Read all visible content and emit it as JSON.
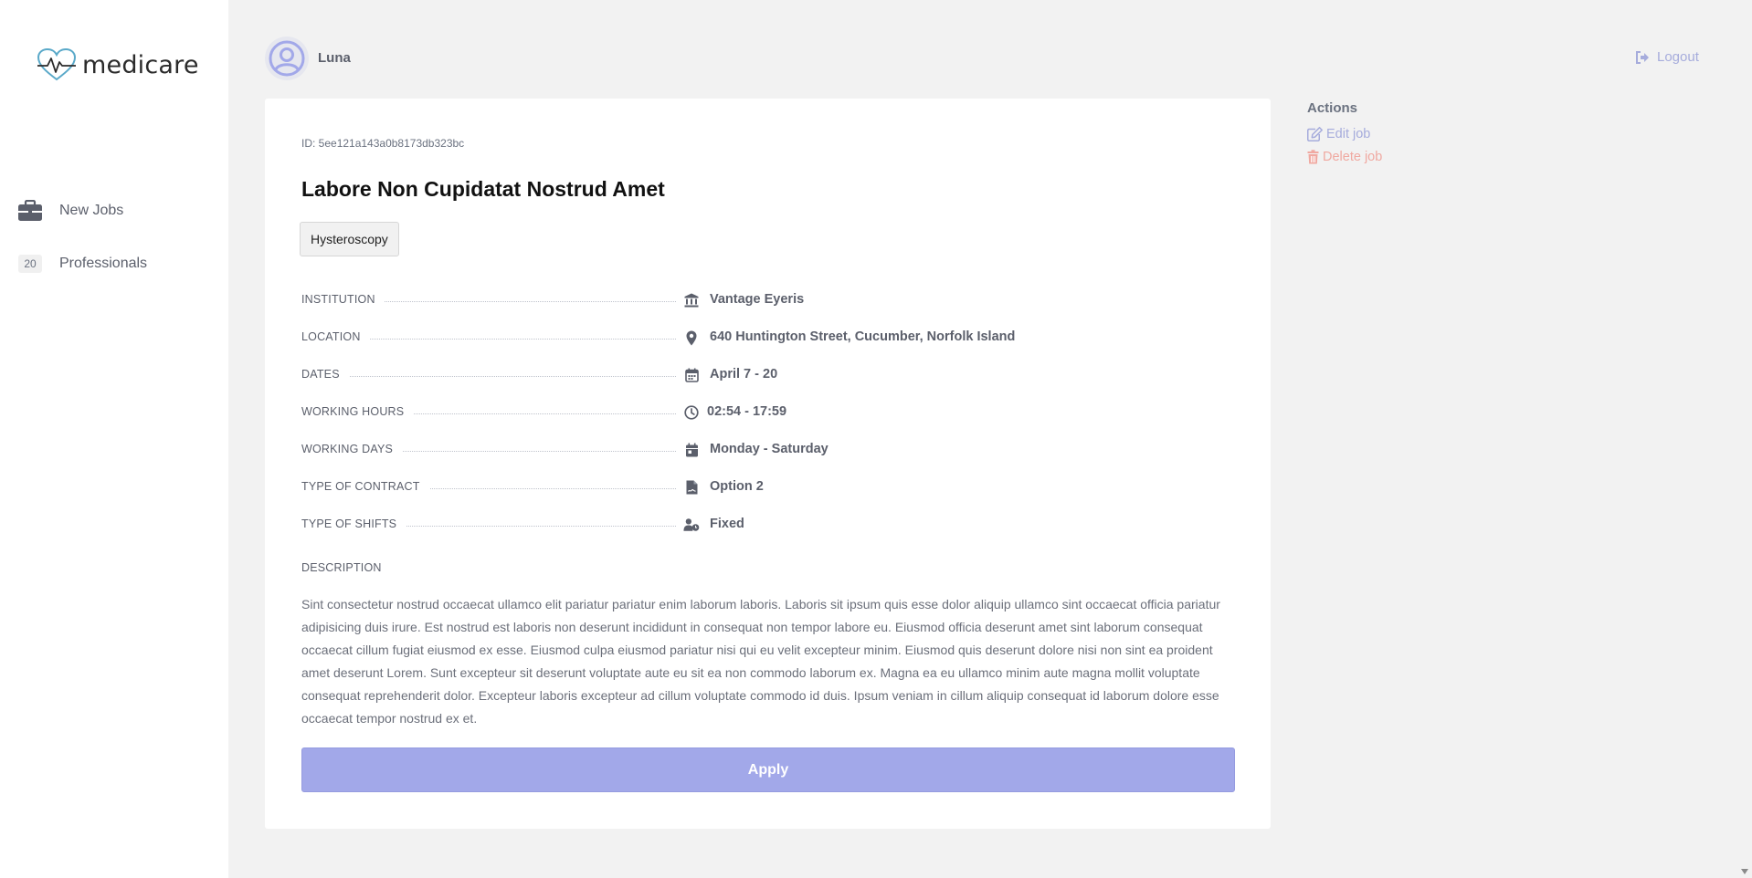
{
  "app": {
    "logo_text": "medicare"
  },
  "sidebar": {
    "items": [
      {
        "label": "New Jobs",
        "icon": "briefcase-icon"
      },
      {
        "label": "Professionals",
        "badge": "20"
      }
    ]
  },
  "header": {
    "username": "Luna",
    "logout_label": "Logout"
  },
  "job": {
    "id_text": "ID: 5ee121a143a0b8173db323bc",
    "title": "Labore Non Cupidatat Nostrud Amet",
    "tag": "Hysteroscopy",
    "details": [
      {
        "label": "INSTITUTION",
        "value": "Vantage Eyeris",
        "icon": "bank-icon"
      },
      {
        "label": "LOCATION",
        "value": "640 Huntington Street, Cucumber, Norfolk Island",
        "icon": "map-pin-icon"
      },
      {
        "label": "DATES",
        "value": "April 7 - 20",
        "icon": "calendar-icon"
      },
      {
        "label": "WORKING HOURS",
        "value": "02:54 - 17:59",
        "icon": "clock-icon"
      },
      {
        "label": "WORKING DAYS",
        "value": "Monday - Saturday",
        "icon": "calendar-day-icon"
      },
      {
        "label": "TYPE OF CONTRACT",
        "value": "Option 2",
        "icon": "file-contract-icon"
      },
      {
        "label": "TYPE OF SHIFTS",
        "value": "Fixed",
        "icon": "user-clock-icon"
      }
    ],
    "description_label": "DESCRIPTION",
    "description": "Sint consectetur nostrud occaecat ullamco elit pariatur pariatur enim laborum laboris. Laboris sit ipsum quis esse dolor aliquip ullamco sint occaecat officia pariatur adipisicing duis irure. Est nostrud est laboris non deserunt incididunt in consequat non tempor labore eu. Eiusmod officia deserunt amet sint laborum consequat occaecat cillum fugiat eiusmod ex esse. Eiusmod culpa eiusmod pariatur nisi qui eu velit excepteur minim. Eiusmod quis deserunt dolore nisi non sint ea proident amet deserunt Lorem. Sunt excepteur sit deserunt voluptate aute eu sit ea non commodo laborum ex. Magna ea eu ullamco minim aute magna mollit voluptate consequat reprehenderit dolor. Excepteur laboris excepteur ad cillum voluptate commodo id duis. Ipsum veniam in cillum aliquip consequat id laborum dolore esse occaecat tempor nostrud ex et.",
    "apply_label": "Apply"
  },
  "actions": {
    "title": "Actions",
    "edit_label": "Edit job",
    "delete_label": "Delete job"
  },
  "colors": {
    "accent": "#a2a8e9",
    "danger": "#f0a9a1",
    "logo_heart": "#5aa9c9"
  }
}
